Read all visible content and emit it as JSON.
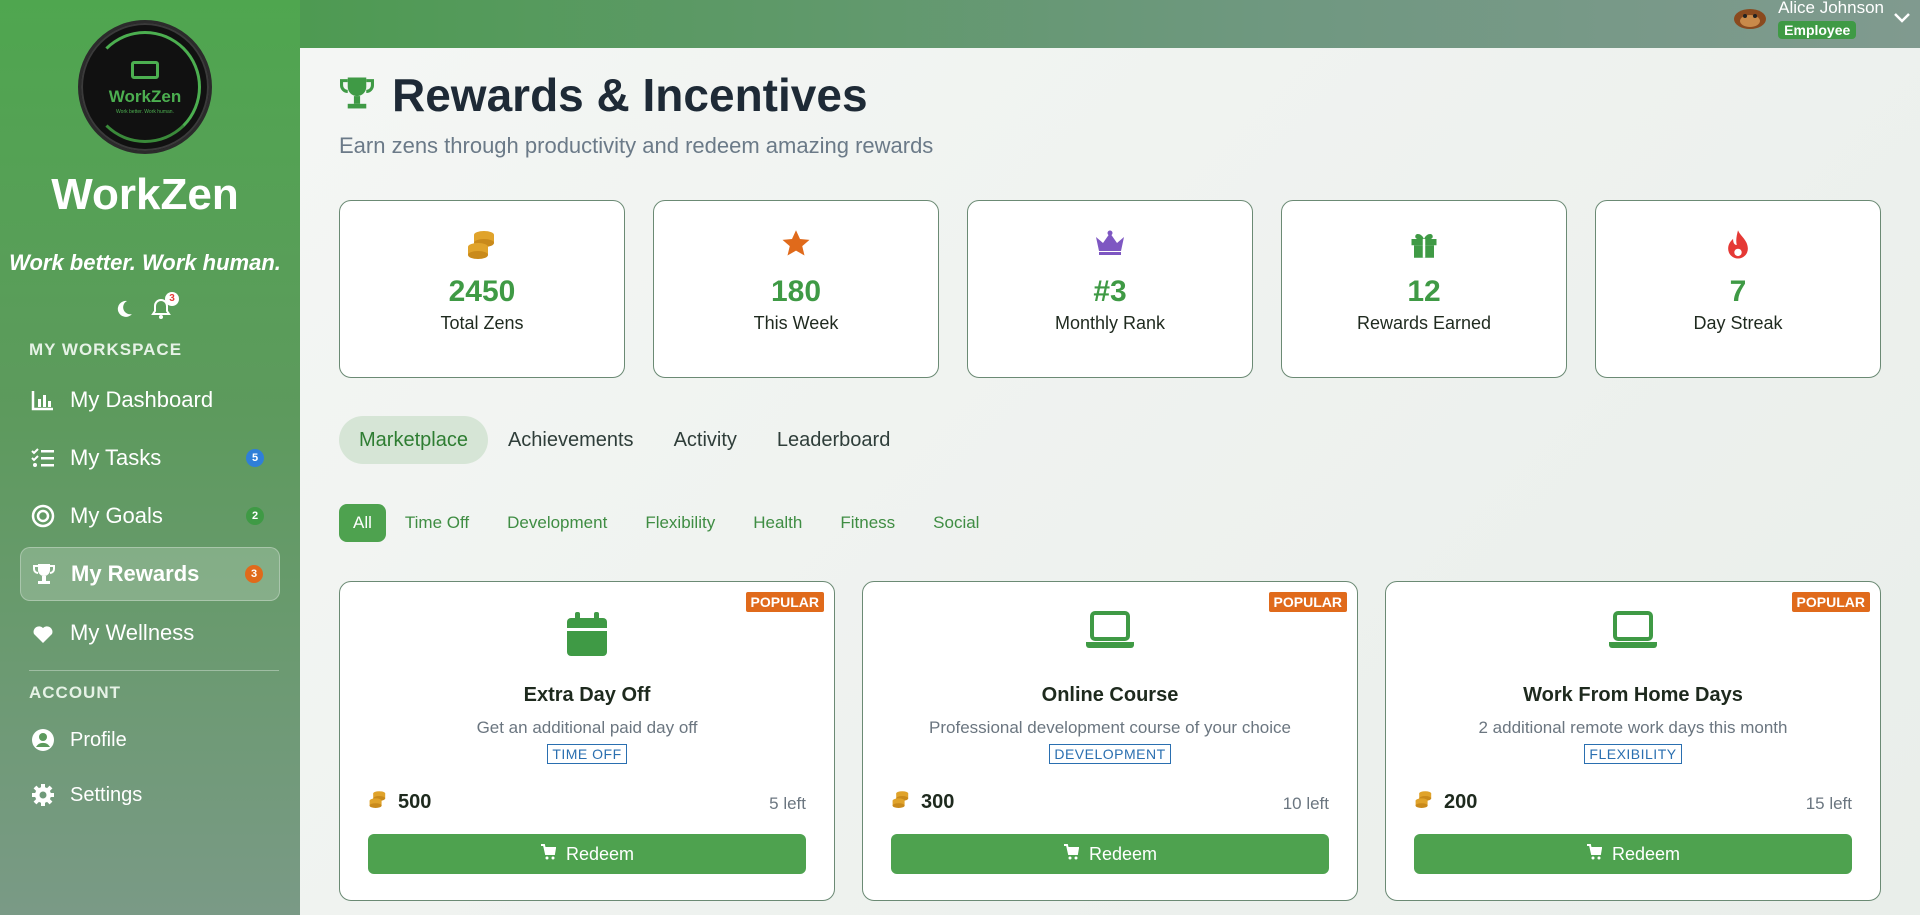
{
  "sidebar": {
    "logo_text": "WorkZen",
    "logo_subtext": "Work better. Work human.",
    "brand": "WorkZen",
    "tagline": "Work better. Work human.",
    "notifications_count": "3",
    "section_workspace": "MY WORKSPACE",
    "section_account": "ACCOUNT",
    "items": [
      {
        "label": "My Dashboard",
        "icon": "chart-bar-icon"
      },
      {
        "label": "My Tasks",
        "icon": "tasks-list-icon",
        "badge": "5",
        "badge_color": "#2f7fd8"
      },
      {
        "label": "My Goals",
        "icon": "target-icon",
        "badge": "2",
        "badge_color": "#3f9a45"
      },
      {
        "label": "My Rewards",
        "icon": "trophy-icon",
        "badge": "3",
        "badge_color": "#e06a1b",
        "active": true
      },
      {
        "label": "My Wellness",
        "icon": "heart-icon"
      }
    ],
    "account_items": [
      {
        "label": "Profile",
        "icon": "user-circle-icon"
      },
      {
        "label": "Settings",
        "icon": "gear-icon"
      }
    ]
  },
  "topbar": {
    "user_name": "Alice Johnson",
    "user_role": "Employee"
  },
  "page": {
    "title": "Rewards & Incentives",
    "subtitle": "Earn zens through productivity and redeem amazing rewards"
  },
  "stats": [
    {
      "value": "2450",
      "label": "Total Zens",
      "icon": "coins-icon",
      "color": "#e0a32b"
    },
    {
      "value": "180",
      "label": "This Week",
      "icon": "star-icon",
      "color": "#e06a1b"
    },
    {
      "value": "#3",
      "label": "Monthly Rank",
      "icon": "crown-icon",
      "color": "#7e57c2"
    },
    {
      "value": "12",
      "label": "Rewards Earned",
      "icon": "gift-icon",
      "color": "#3f9a45"
    },
    {
      "value": "7",
      "label": "Day Streak",
      "icon": "fire-icon",
      "color": "#e53935"
    }
  ],
  "tabs": [
    "Marketplace",
    "Achievements",
    "Activity",
    "Leaderboard"
  ],
  "filters": [
    "All",
    "Time Off",
    "Development",
    "Flexibility",
    "Health",
    "Fitness",
    "Social"
  ],
  "rewards": [
    {
      "badge": "POPULAR",
      "title": "Extra Day Off",
      "description": "Get an additional paid day off",
      "category": "TIME OFF",
      "cost": "500",
      "left": "5 left",
      "button": "Redeem",
      "icon": "calendar-icon"
    },
    {
      "badge": "POPULAR",
      "title": "Online Course",
      "description": "Professional development course of your choice",
      "category": "DEVELOPMENT",
      "cost": "300",
      "left": "10 left",
      "button": "Redeem",
      "icon": "laptop-icon"
    },
    {
      "badge": "POPULAR",
      "title": "Work From Home Days",
      "description": "2 additional remote work days this month",
      "category": "FLEXIBILITY",
      "cost": "200",
      "left": "15 left",
      "button": "Redeem",
      "icon": "laptop-icon"
    }
  ],
  "colors": {
    "primary": "#4ea24f",
    "accent": "#e06a1b",
    "category": "#2a6fb0"
  }
}
